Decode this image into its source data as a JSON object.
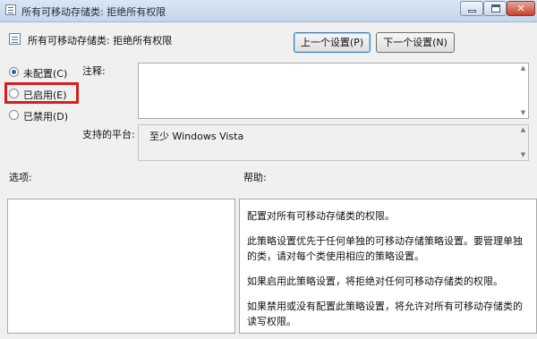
{
  "window": {
    "title": "所有可移动存储类: 拒绝所有权限",
    "controls": {
      "minimize_icon": "minimize-icon",
      "maximize_icon": "maximize-icon",
      "close_icon": "close-icon",
      "close_glyph": "✕"
    }
  },
  "header": {
    "policy_title": "所有可移动存储类: 拒绝所有权限",
    "prev_button": "上一个设置(P)",
    "next_button": "下一个设置(N)"
  },
  "state": {
    "options": [
      {
        "label": "未配置(C)",
        "checked": true
      },
      {
        "label": "已启用(E)",
        "checked": false
      },
      {
        "label": "已禁用(D)",
        "checked": false
      }
    ]
  },
  "comment": {
    "label": "注释:",
    "value": ""
  },
  "supported": {
    "label": "支持的平台:",
    "value": "至少 Windows Vista"
  },
  "options_panel": {
    "label": "选项:"
  },
  "help_panel": {
    "label": "帮助:",
    "paragraphs": [
      "配置对所有可移动存储类的权限。",
      "此策略设置优先于任何单独的可移动存储策略设置。要管理单独的类，请对每个类使用相应的策略设置。",
      "如果启用此策略设置，将拒绝对任何可移动存储类的权限。",
      "如果禁用或没有配置此策略设置，将允许对所有可移动存储类的读写权限。"
    ]
  },
  "colors": {
    "highlight": "#d81e1e",
    "titlebar": "#c4d6ec",
    "window_bg": "#f0f0f0"
  }
}
